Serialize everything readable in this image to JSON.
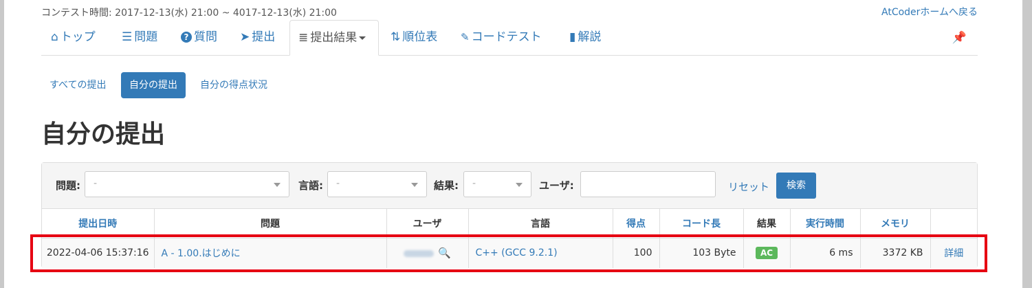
{
  "header": {
    "contest_time": "コンテスト時間: 2017-12-13(水) 21:00 ~ 4017-12-13(水) 21:00",
    "home_link": "AtCoderホームへ戻る"
  },
  "nav": {
    "items": [
      {
        "icon": "home-icon",
        "glyph": "⌂",
        "label": "トップ"
      },
      {
        "icon": "tasks-icon",
        "glyph": "☰",
        "label": "問題"
      },
      {
        "icon": "question-icon",
        "glyph": "?",
        "label": "質問"
      },
      {
        "icon": "send-icon",
        "glyph": "➤",
        "label": "提出"
      },
      {
        "icon": "list-icon",
        "glyph": "≣",
        "label": "提出結果"
      },
      {
        "icon": "sort-icon",
        "glyph": "⇅",
        "label": "順位表"
      },
      {
        "icon": "wrench-icon",
        "glyph": "🔧",
        "label": "コードテスト"
      },
      {
        "icon": "book-icon",
        "glyph": "▮",
        "label": "解説"
      }
    ],
    "pin_icon": "pushpin-icon"
  },
  "pills": {
    "all": "すべての提出",
    "mine": "自分の提出",
    "score": "自分の得点状況"
  },
  "page_title": "自分の提出",
  "filters": {
    "task_label": "問題:",
    "task_value": "-",
    "lang_label": "言語:",
    "lang_value": "-",
    "status_label": "結果:",
    "status_value": "-",
    "user_label": "ユーザ:",
    "user_value": "",
    "reset": "リセット",
    "search": "検索"
  },
  "table": {
    "headers": [
      "提出日時",
      "問題",
      "ユーザ",
      "言語",
      "得点",
      "コード長",
      "結果",
      "実行時間",
      "メモリ",
      ""
    ],
    "rows": [
      {
        "time": "2022-04-06 15:37:16",
        "task": "A - 1.00.はじめに",
        "user": "",
        "lang": "C++ (GCC 9.2.1)",
        "score": "100",
        "code_len": "103 Byte",
        "status": "AC",
        "exec_time": "6 ms",
        "memory": "3372 KB",
        "detail": "詳細"
      }
    ]
  },
  "colors": {
    "link": "#337ab7",
    "ac_badge": "#5cb85c",
    "highlight": "#e60012"
  }
}
